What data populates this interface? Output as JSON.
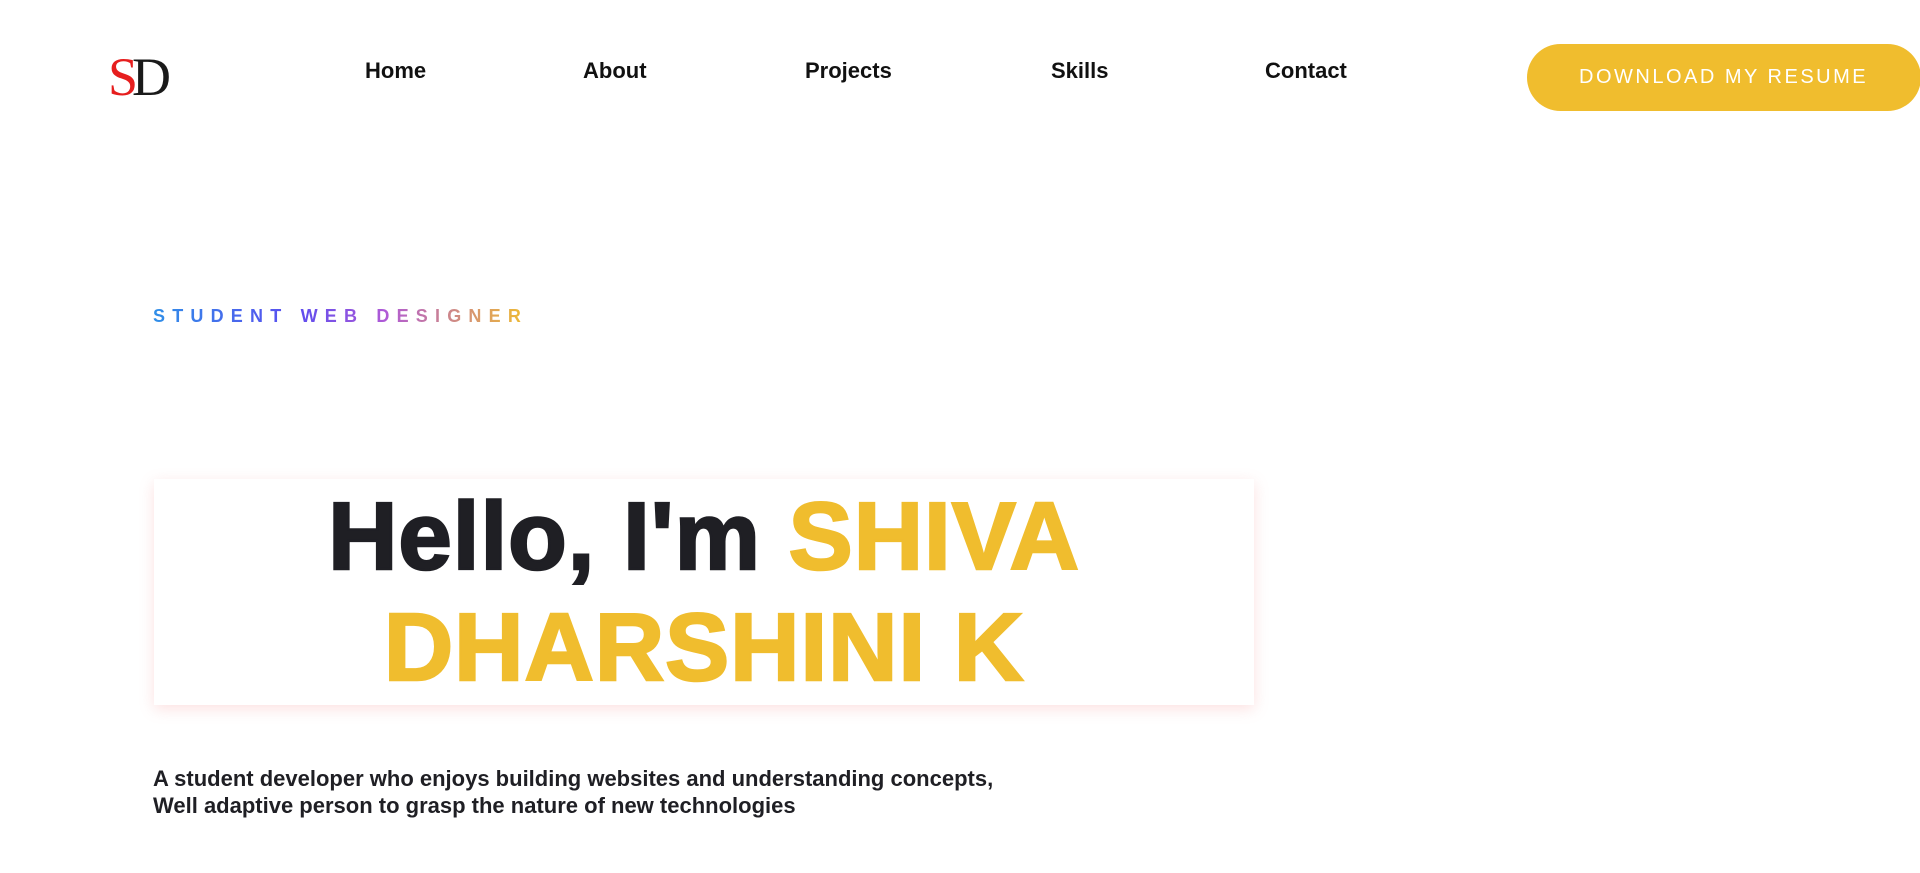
{
  "logo": {
    "s": "S",
    "d": "D"
  },
  "nav": {
    "items": [
      {
        "label": "Home"
      },
      {
        "label": "About"
      },
      {
        "label": "Projects"
      },
      {
        "label": "Skills"
      },
      {
        "label": "Contact"
      }
    ],
    "resume_button": "DOWNLOAD MY RESUME"
  },
  "hero": {
    "tagline": "STUDENT WEB DESIGNER",
    "greeting": "Hello, I'm",
    "name_line1": "SHIVA",
    "name_line2": "DHARSHINI K",
    "intro_line1": "A student developer who enjoys building websites and understanding concepts,",
    "intro_line2": "Well adaptive person to grasp the nature of new technologies"
  },
  "colors": {
    "accent": "#f0bd2e",
    "logo_s": "#e61e1e",
    "text_dark": "#1f1f24"
  }
}
